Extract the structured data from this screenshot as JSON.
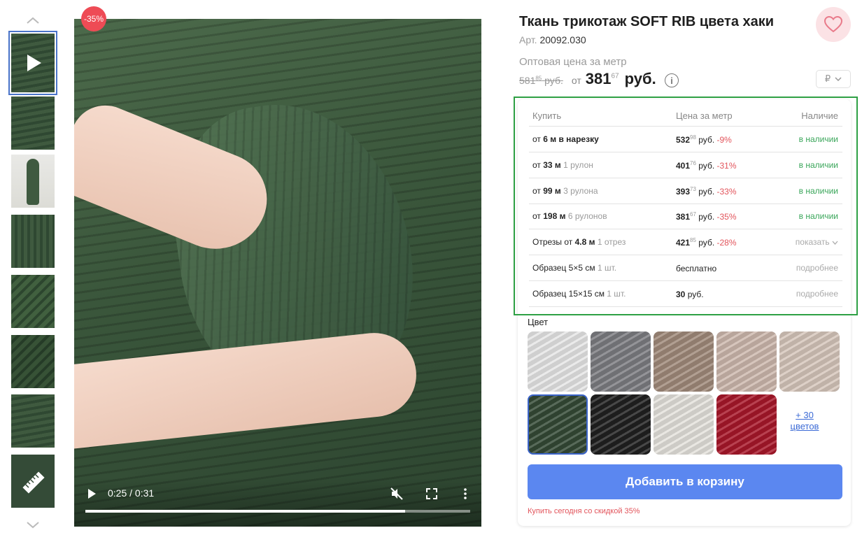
{
  "badge": "-35%",
  "product": {
    "title": "Ткань трикотаж SOFT RIB цвета хаки",
    "article_label": "Арт.",
    "article": "20092.030",
    "wholesale_label": "Оптовая цена за метр",
    "old_price_main": "581",
    "old_price_cents": "85",
    "old_price_unit": "руб.",
    "from_label": "от",
    "price_main": "381",
    "price_cents": "67",
    "price_unit": "руб.",
    "info_icon": "i",
    "currency": "₽"
  },
  "video": {
    "time": "0:25 / 0:31",
    "progress": 0.83
  },
  "table": {
    "headers": [
      "Купить",
      "Цена за метр",
      "Наличие"
    ],
    "rows": [
      {
        "pre": "от ",
        "qty": "6 м в нарезку",
        "note": "",
        "price": "532",
        "cents": "98",
        "unit": " руб.",
        "disc": " -9%",
        "status": "в наличии"
      },
      {
        "pre": "от ",
        "qty": "33 м",
        "note": " 1 рулон",
        "price": "401",
        "cents": "76",
        "unit": " руб.",
        "disc": " -31%",
        "status": "в наличии"
      },
      {
        "pre": "от ",
        "qty": "99 м",
        "note": " 3 рулона",
        "price": "393",
        "cents": "73",
        "unit": " руб.",
        "disc": " -33%",
        "status": "в наличии"
      },
      {
        "pre": "от ",
        "qty": "198 м",
        "note": " 6 рулонов",
        "price": "381",
        "cents": "67",
        "unit": " руб.",
        "disc": " -35%",
        "status": "в наличии"
      },
      {
        "pre": "Отрезы от ",
        "qty": "4.8 м",
        "note": " 1 отрез",
        "price": "421",
        "cents": "85",
        "unit": " руб.",
        "disc": " -28%",
        "status": "показать"
      },
      {
        "pre": "Образец 5×5 см",
        "qty": "",
        "note": " 1 шт.",
        "price": "бесплатно",
        "cents": "",
        "unit": "",
        "disc": "",
        "status": "подробнее"
      },
      {
        "pre": "Образец 15×15 см",
        "qty": "",
        "note": " 1 шт.",
        "price": "30",
        "cents": "",
        "unit": " руб.",
        "disc": "",
        "status": "подробнее"
      }
    ]
  },
  "colors": {
    "label": "Цвет",
    "swatches": [
      "#e6e6e6",
      "#7c7d81",
      "#a08a7a",
      "#cdb8ad",
      "#d6c6bb",
      "#344a36",
      "#202020",
      "#e4e2dc",
      "#a8172a"
    ],
    "selected": 5,
    "more_line1": "+ 30",
    "more_line2": "цветов"
  },
  "cart": {
    "button": "Добавить в корзину",
    "promo": "Купить сегодня со скидкой 35%"
  }
}
